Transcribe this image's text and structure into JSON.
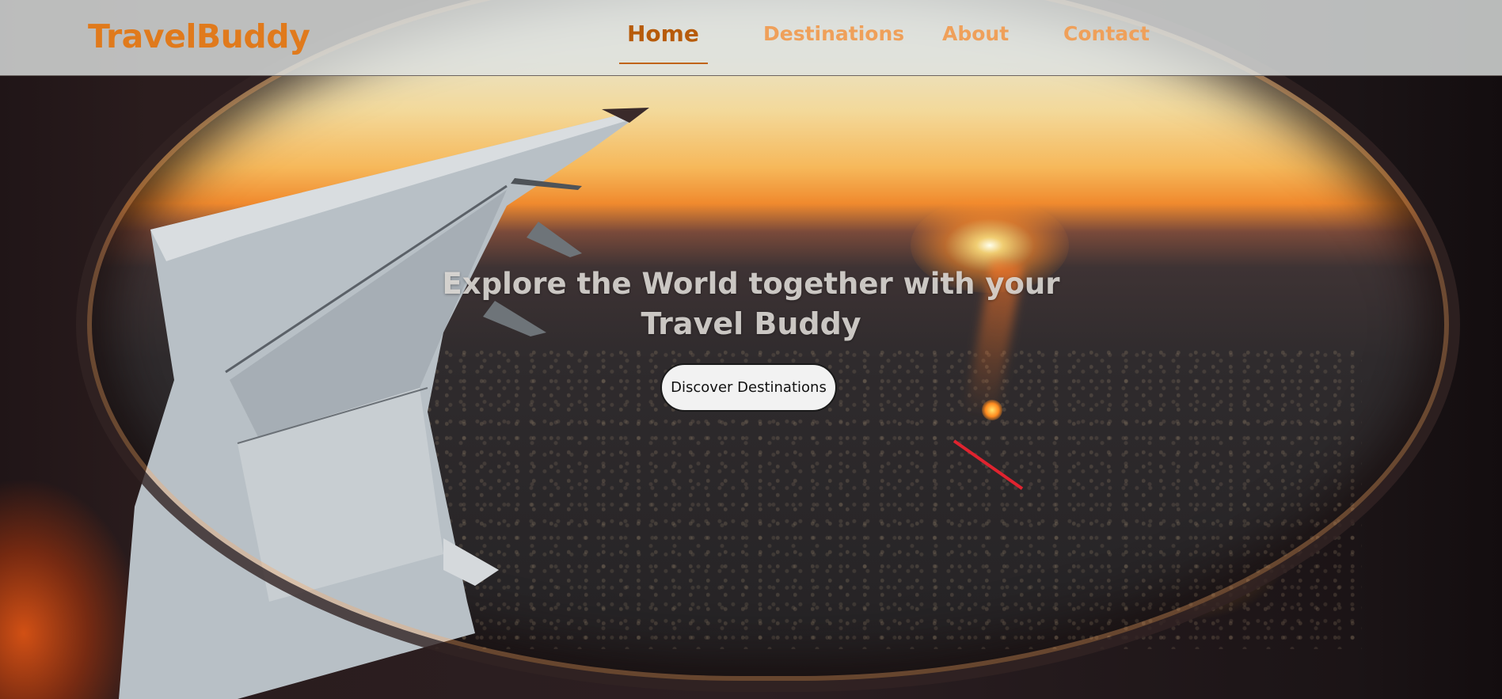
{
  "brand": {
    "name": "TravelBuddy",
    "color": "#e07a1c"
  },
  "nav": {
    "items": [
      {
        "label": "Home",
        "active": true
      },
      {
        "label": "Destinations",
        "active": false
      },
      {
        "label": "About",
        "active": false
      },
      {
        "label": "Contact",
        "active": false
      }
    ],
    "active_color": "#b75b0a",
    "inactive_color": "#efa05a"
  },
  "hero": {
    "title_line1": "Explore the World together with your",
    "title_line2": "Travel Buddy",
    "cta_label": "Discover Destinations",
    "background": "airplane-window-sunset-photo"
  }
}
